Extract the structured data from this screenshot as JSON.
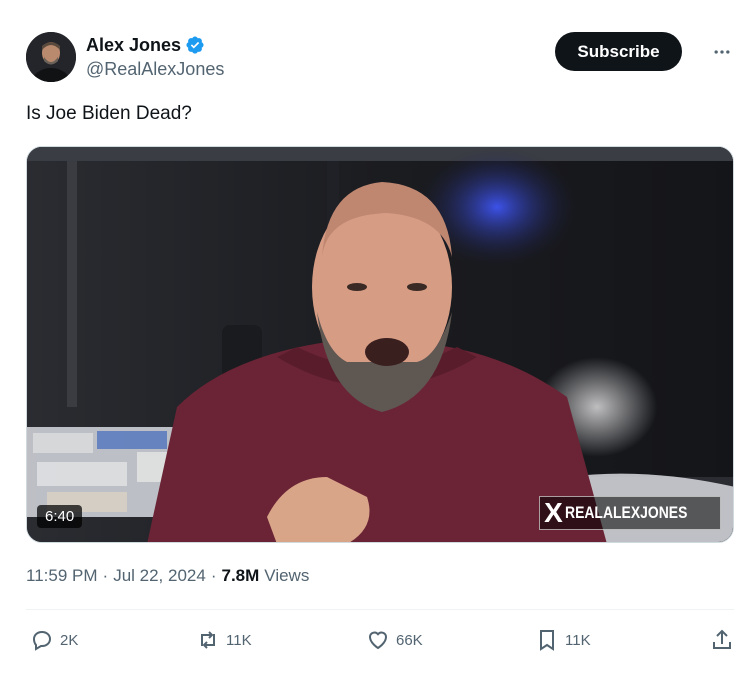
{
  "author": {
    "display_name": "Alex Jones",
    "handle": "@RealAlexJones",
    "verified": true
  },
  "header": {
    "subscribe_label": "Subscribe"
  },
  "tweet": {
    "text": "Is Joe Biden Dead?",
    "time": "11:59 PM",
    "separator": "·",
    "date": "Jul 22, 2024",
    "views_count": "7.8M",
    "views_label": "Views"
  },
  "media": {
    "duration": "6:40",
    "watermark_text": "REALALEXJONES"
  },
  "actions": {
    "replies": "2K",
    "reposts": "11K",
    "likes": "66K",
    "bookmarks": "11K"
  },
  "colors": {
    "text_primary": "#0f1419",
    "text_secondary": "#536471",
    "verified_blue": "#1d9bf0",
    "button_dark": "#0f1419"
  },
  "icons": [
    "verified-badge-icon",
    "more-icon",
    "reply-icon",
    "repost-icon",
    "like-icon",
    "bookmark-icon",
    "share-icon"
  ]
}
